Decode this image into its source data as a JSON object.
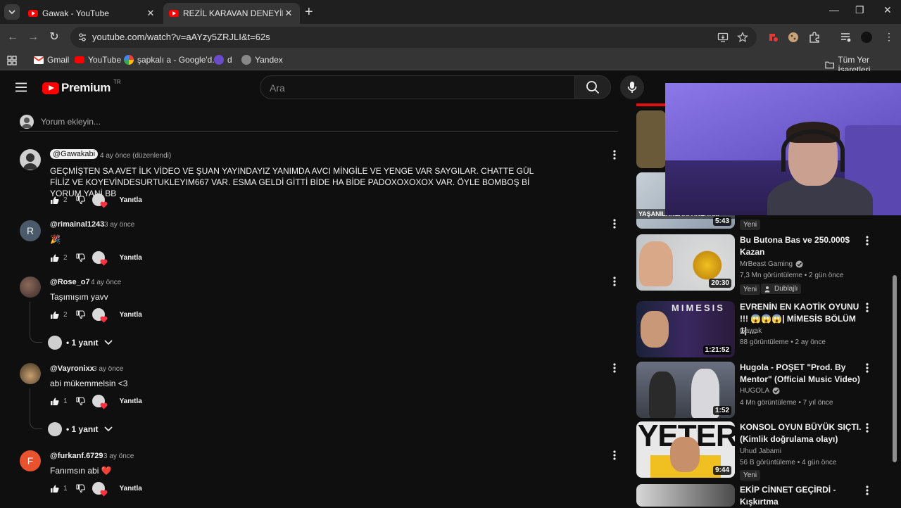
{
  "browser": {
    "tabs": [
      {
        "title": "Gawak - YouTube",
        "active": false
      },
      {
        "title": "REZİL KARAVAN DENEYİMİ! RV",
        "active": true
      }
    ],
    "url": "youtube.com/watch?v=aAYzy5ZRJLI&t=62s",
    "bookmarks": [
      "Gmail",
      "YouTube",
      "şapkalı a - Google'd...",
      "d",
      "Yandex"
    ],
    "all_bookmarks": "Tüm Yer İşaretleri"
  },
  "youtube": {
    "logo_word": "Premium",
    "country_code": "TR",
    "search_placeholder": "Ara",
    "add_comment_placeholder": "Yorum ekleyin..."
  },
  "comments": [
    {
      "author": "@Gawakabi",
      "time": "4 ay önce (düzenlendi)",
      "text": "GEÇMİŞTEN SA AVET İLK VİDEO VE ŞUAN YAYINDAYIZ YANIMDA AVCI MİNGİLE VE YENGE VAR SAYGILAR. CHATTE GÜL FİLİZ VE KOYEVİNDESURTUKLEYIM667 VAR. ESMA GELDİ GİTTİ BİDE HA BİDE  PADOXOXOXOX VAR. ÖYLE BOMBOŞ Bİ YORUM YANİ BB",
      "likes": "2",
      "reply_label": "Yanıtla"
    },
    {
      "author": "@rimainal1243",
      "time": "3 ay önce",
      "text": "🎉",
      "likes": "2",
      "reply_label": "Yanıtla",
      "avatar_letter": "R"
    },
    {
      "author": "@Rose_o7",
      "time": "4 ay önce",
      "text": "Taşımışım yavv",
      "likes": "2",
      "reply_label": "Yanıtla",
      "replies": "• 1 yanıt"
    },
    {
      "author": "@Vayronixx",
      "time": "3 ay önce",
      "text": "abi mükemmelsin <3",
      "likes": "1",
      "reply_label": "Yanıtla",
      "replies": "• 1 yanıt"
    },
    {
      "author": "@furkanf.6729",
      "time": "3 ay önce",
      "text": "Fanımsın abi ❤️",
      "likes": "1",
      "reply_label": "Yanıtla",
      "avatar_letter": "F"
    }
  ],
  "sidebar": {
    "partial_item": {
      "duration": "5:43",
      "chip": "Yeni",
      "overlay_text": "YAŞANILANLARI ANLATI..."
    },
    "videos": [
      {
        "title": "Bu Butona Bas ve 250.000$ Kazan",
        "channel": "MrBeast Gaming",
        "verified": true,
        "meta": "7,3 Mn görüntüleme • 2 gün önce",
        "duration": "20:30",
        "chips": [
          "Yeni",
          "Dublajlı"
        ]
      },
      {
        "title": "EVRENİN EN KAOTİK OYUNU !!! 😱😱😱| MİMESİS BÖLÜM 1| ...",
        "channel": "Gawak",
        "verified": false,
        "meta": "88 görüntüleme • 2 ay önce",
        "duration": "1:21:52",
        "chips": []
      },
      {
        "title": "Hugola - POŞET  \"Prod. By Mentor\" (Official Music Video)",
        "channel": "HUGOLA",
        "verified": true,
        "meta": "4 Mn görüntüleme • 7 yıl önce",
        "duration": "1:52",
        "chips": []
      },
      {
        "title": "KONSOL OYUN BÜYÜK SIÇTI.(Kimlik doğrulama olayı)",
        "channel": "Uhud Jabami",
        "verified": false,
        "meta": "56 B görüntüleme • 4 gün önce",
        "duration": "9:44",
        "chips": [
          "Yeni"
        ]
      },
      {
        "title": "EKİP CİNNET GEÇİRDİ - Kışkırtma",
        "channel": "",
        "verified": false,
        "meta": "",
        "duration": "",
        "chips": []
      }
    ]
  },
  "thumb_texts": {
    "mimesis": "MIMESIS",
    "yeter": "YETER"
  },
  "colors": {
    "accent": "#ff0000",
    "background": "#0f0f0f",
    "text": "#f1f1f1",
    "muted": "#aaaaaa"
  }
}
